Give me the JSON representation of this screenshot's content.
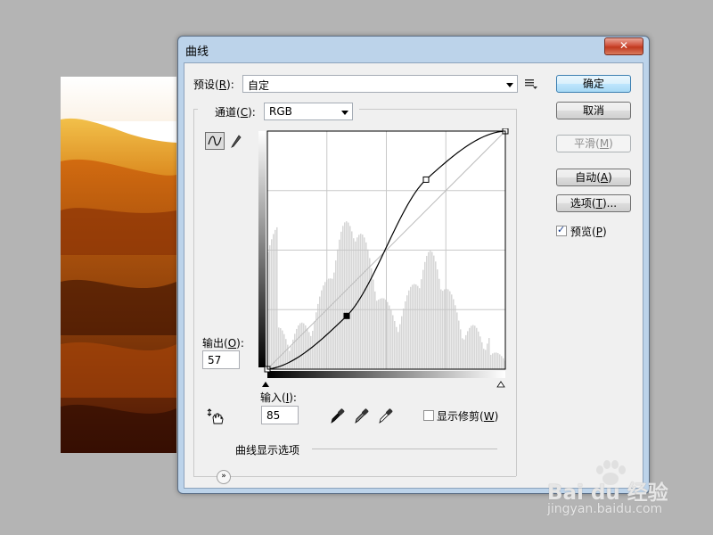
{
  "dialog": {
    "title": "曲线",
    "close_label": "✕",
    "preset": {
      "label_prefix": "预设(",
      "label_key": "R",
      "label_suffix": "):",
      "value": "自定"
    },
    "channel": {
      "label_prefix": "通道(",
      "label_key": "C",
      "label_suffix": "):",
      "value": "RGB"
    },
    "output": {
      "label_prefix": "输出(",
      "label_key": "O",
      "label_suffix": "):",
      "value": "57"
    },
    "input": {
      "label_prefix": "输入(",
      "label_key": "I",
      "label_suffix": "):",
      "value": "85"
    },
    "buttons": {
      "ok": "确定",
      "cancel": "取消",
      "smooth": {
        "prefix": "平滑(",
        "key": "M",
        "suffix": ")"
      },
      "auto": {
        "prefix": "自动(",
        "key": "A",
        "suffix": ")"
      },
      "options": {
        "prefix": "选项(",
        "key": "T",
        "suffix": ")..."
      }
    },
    "preview": {
      "prefix": "预览(",
      "key": "P",
      "suffix": ")",
      "checked": true
    },
    "show_clipping": {
      "prefix": "显示修剪(",
      "key": "W",
      "suffix": ")",
      "checked": false
    },
    "curve_display_options": "曲线显示选项"
  },
  "icons": {
    "preset_menu": "preset-menu-icon",
    "curve_tool": "curve-tool-icon",
    "pencil_tool": "pencil-tool-icon",
    "hand_tool": "on-image-adjust-icon",
    "black_eyedropper": "black-point-eyedropper-icon",
    "gray_eyedropper": "gray-point-eyedropper-icon",
    "white_eyedropper": "white-point-eyedropper-icon",
    "expand": "expand-chevron-icon"
  },
  "colors": {
    "titlebar": "#bcd3ea",
    "client": "#f0f0f0",
    "default_button": "#bee6fd",
    "close_button": "#c0391f"
  },
  "chart_data": {
    "type": "line",
    "xlim": [
      0,
      255
    ],
    "ylim": [
      0,
      255
    ],
    "grid": true,
    "series": [
      {
        "values_x": [
          0,
          85,
          170,
          255
        ],
        "values_y": [
          0,
          57,
          203,
          255
        ]
      }
    ],
    "selected_point": {
      "x": 85,
      "y": 57
    }
  },
  "watermark": {
    "brand": "Bai du 经验",
    "url": "jingyan.baidu.com"
  }
}
